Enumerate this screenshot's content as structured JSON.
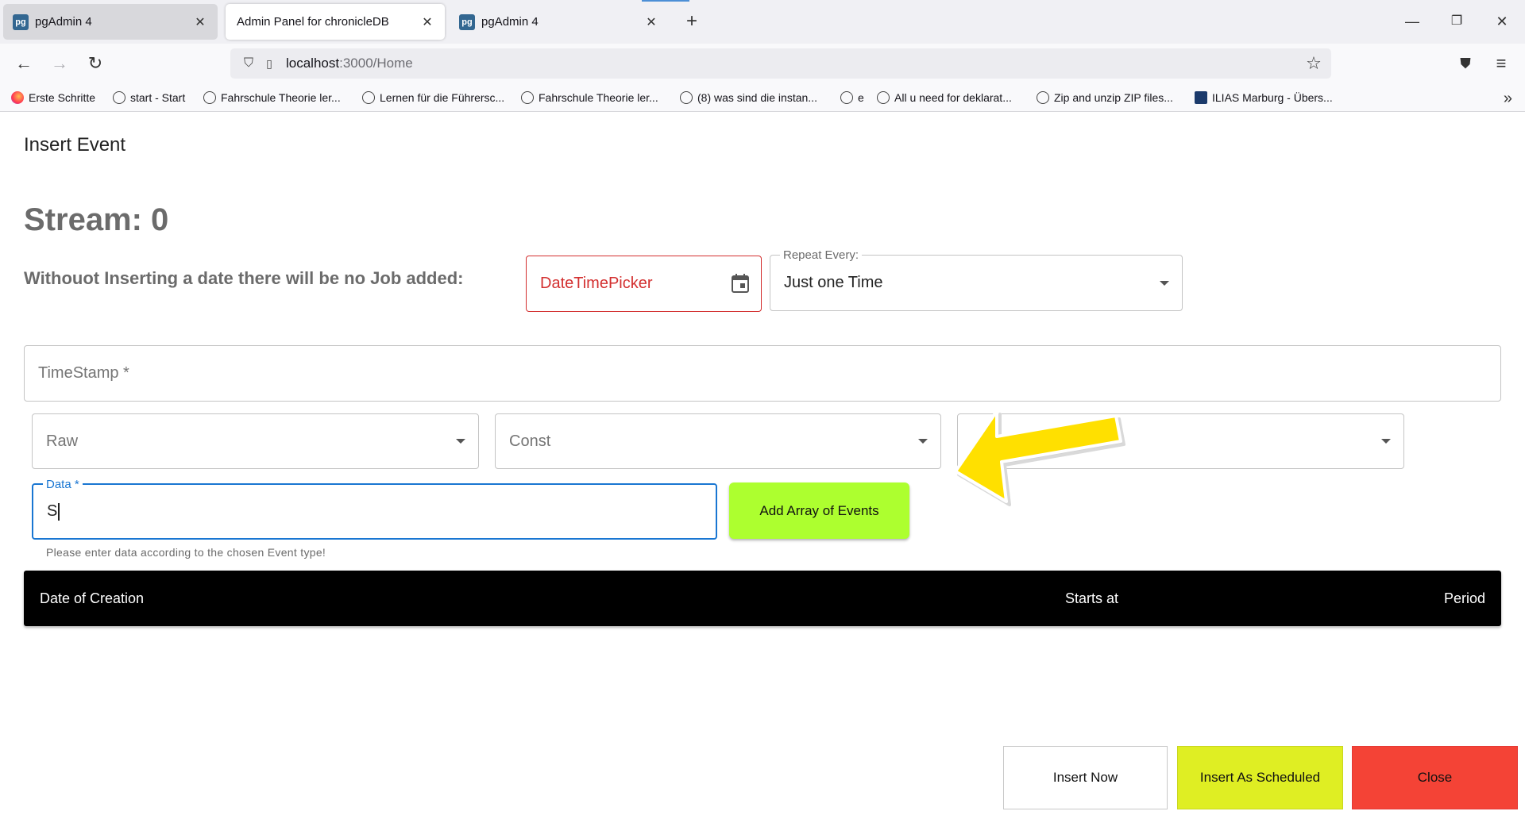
{
  "browser": {
    "tabs": [
      {
        "label": "pgAdmin 4",
        "favicon": "pg",
        "active": false
      },
      {
        "label": "Admin Panel for chronicleDB",
        "active": true
      },
      {
        "label": "pgAdmin 4",
        "favicon": "pg",
        "active": false
      }
    ],
    "url_host": "localhost",
    "url_path": ":3000/Home",
    "bookmarks": [
      "Erste Schritte",
      "start - Start",
      "Fahrschule Theorie ler...",
      "Lernen für die Führersc...",
      "Fahrschule Theorie ler...",
      "(8) was sind die instan...",
      "e",
      "All u need for deklarat...",
      "Zip and unzip ZIP files...",
      "ILIAS Marburg - Übers..."
    ]
  },
  "dialog": {
    "title": "Insert Event",
    "stream_title": "Stream: 0",
    "notice": "Withouot Inserting a date there will be no Job added:",
    "datetime_picker": "DateTimePicker",
    "repeat_label": "Repeat Every:",
    "repeat_value": "Just one Time",
    "timestamp_placeholder": "TimeStamp *",
    "select_raw": "Raw",
    "select_const": "Const",
    "data_label": "Data *",
    "data_value": "S",
    "data_helper": "Please enter data according to the chosen Event type!",
    "add_array_button": "Add Array of Events",
    "table_columns": [
      "Date of Creation",
      "Starts at",
      "Period"
    ],
    "insert_now_button": "Insert Now",
    "insert_scheduled_button": "Insert As Scheduled",
    "close_button": "Close"
  },
  "colors": {
    "add_array_bg": "#adff2f",
    "scheduled_bg": "#dfee23",
    "close_bg": "#f44336",
    "error_red": "#d32f2f",
    "focus_blue": "#1976d2",
    "annotation_arrow": "#ffe000"
  }
}
